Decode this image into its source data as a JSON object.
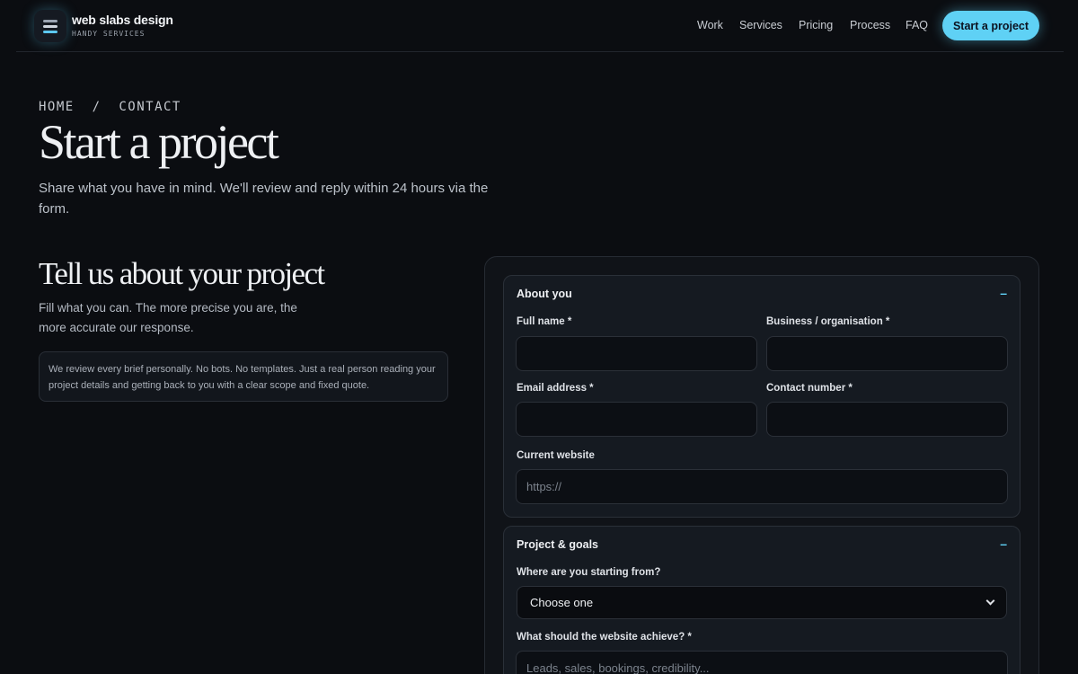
{
  "brand": {
    "name": "web slabs design",
    "tagline": "HANDY SERVICES"
  },
  "nav": {
    "items": [
      "Work",
      "Services",
      "Pricing",
      "Process",
      "FAQ"
    ],
    "cta": "Start a project"
  },
  "hero": {
    "breadcrumb": "HOME  /  CONTACT",
    "title": "Start a project",
    "lead": "Share what you have in mind. We'll review and reply within 24 hours via the form."
  },
  "intro": {
    "title": "Tell us about your project",
    "subtitle": "Fill what you can. The more precise you are, the more accurate our response.",
    "note": "We review every brief personally. No bots. No templates. Just a real person reading your project details and getting back to you with a clear scope and fixed quote."
  },
  "form": {
    "about": {
      "title": "About you",
      "toggle": "–",
      "full_name": {
        "label": "Full name *",
        "value": ""
      },
      "business": {
        "label": "Business / organisation *",
        "value": ""
      },
      "email": {
        "label": "Email address *",
        "value": ""
      },
      "phone": {
        "label": "Contact number *",
        "value": ""
      },
      "website": {
        "label": "Current website",
        "placeholder": "https://"
      }
    },
    "project": {
      "title": "Project & goals",
      "toggle": "–",
      "starting": {
        "label": "Where are you starting from?",
        "selected": "Choose one"
      },
      "goal": {
        "label": "What should the website achieve? *",
        "placeholder": "Leads, sales, bookings, credibility..."
      }
    }
  },
  "colors": {
    "accent": "#5fd1f5",
    "background": "#0b0d11",
    "panel": "#151a21"
  }
}
